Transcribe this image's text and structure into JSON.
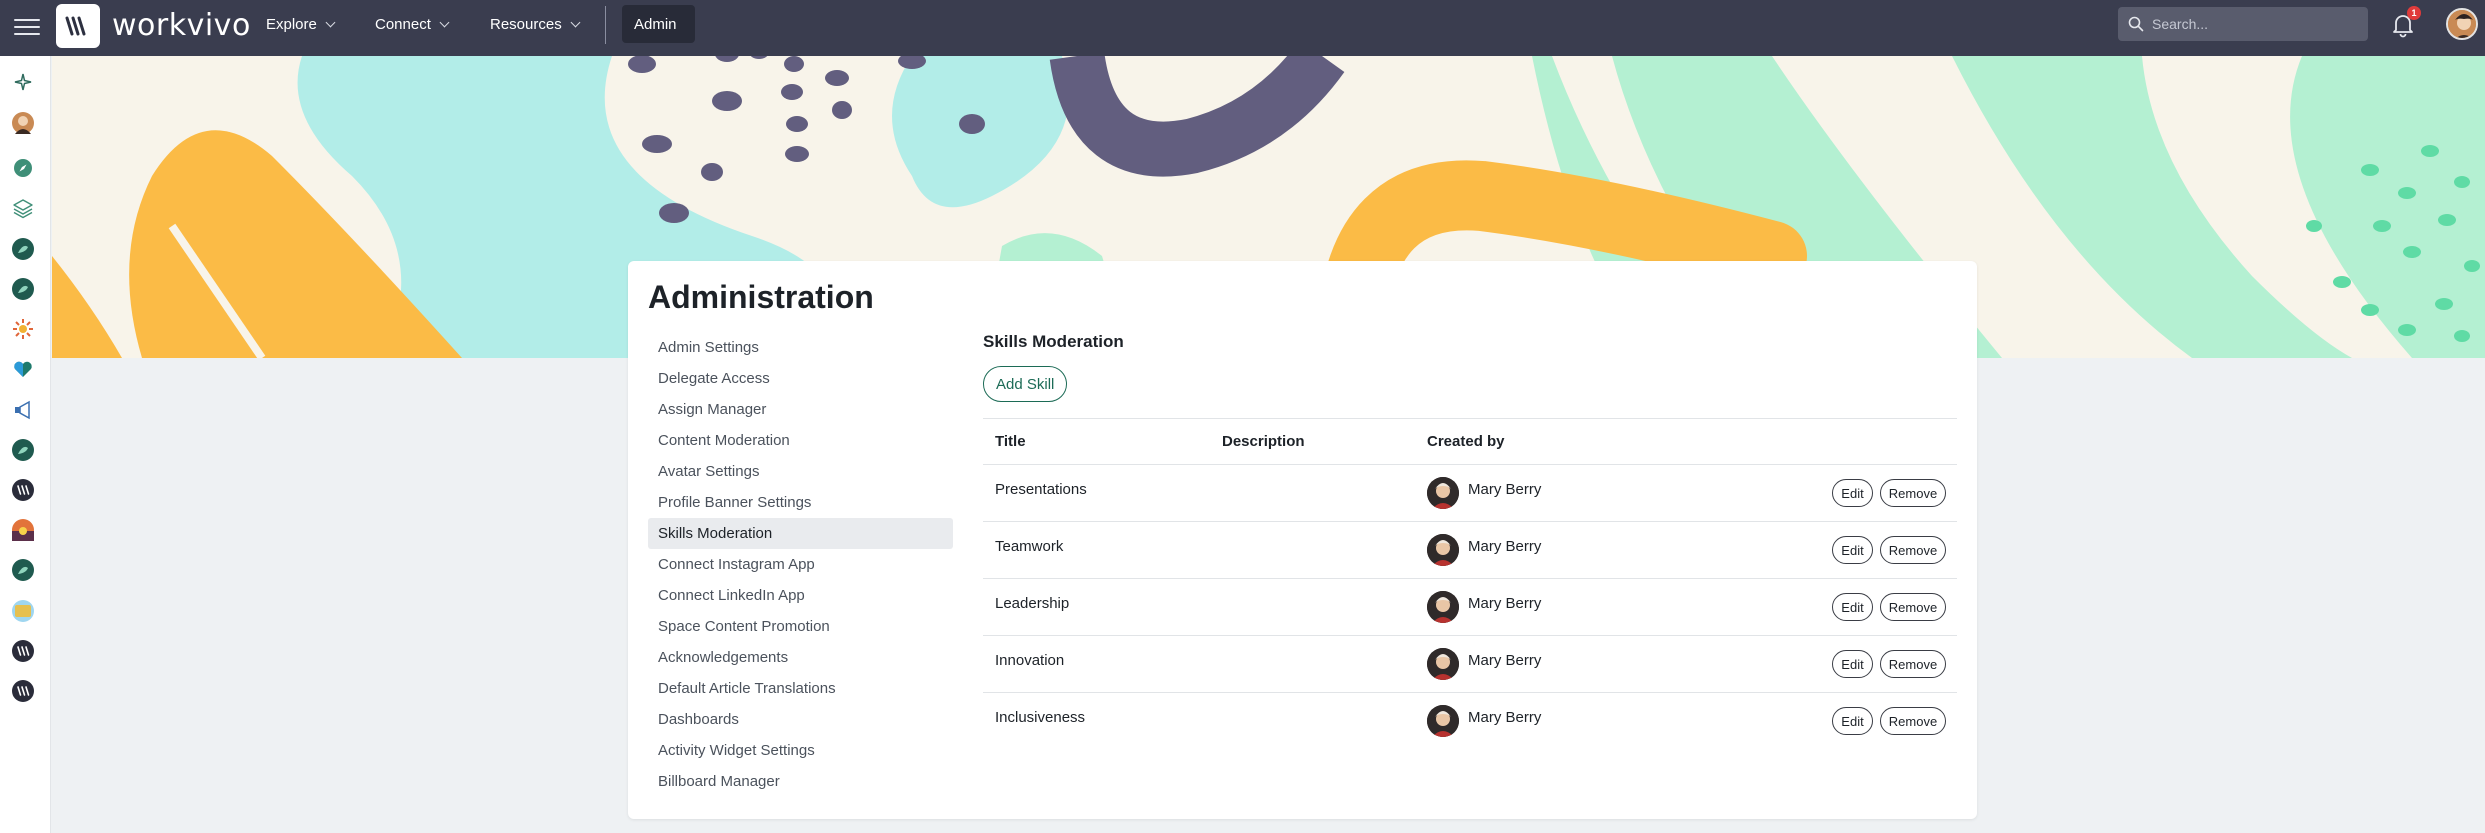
{
  "header": {
    "logo_text": "workvivo",
    "nav": [
      {
        "label": "Explore"
      },
      {
        "label": "Connect"
      },
      {
        "label": "Resources"
      }
    ],
    "admin_label": "Admin",
    "search_placeholder": "Search...",
    "notification_count": "1"
  },
  "page": {
    "title": "Administration"
  },
  "sidebar": {
    "items": [
      {
        "label": "Admin Settings"
      },
      {
        "label": "Delegate Access"
      },
      {
        "label": "Assign Manager"
      },
      {
        "label": "Content Moderation"
      },
      {
        "label": "Avatar Settings"
      },
      {
        "label": "Profile Banner Settings"
      },
      {
        "label": "Skills Moderation",
        "active": true
      },
      {
        "label": "Connect Instagram App"
      },
      {
        "label": "Connect LinkedIn App"
      },
      {
        "label": "Space Content Promotion"
      },
      {
        "label": "Acknowledgements"
      },
      {
        "label": "Default Article Translations"
      },
      {
        "label": "Dashboards"
      },
      {
        "label": "Activity Widget Settings"
      },
      {
        "label": "Billboard Manager"
      }
    ]
  },
  "skills": {
    "title": "Skills Moderation",
    "add_label": "Add Skill",
    "columns": {
      "title": "Title",
      "description": "Description",
      "created_by": "Created by"
    },
    "edit_label": "Edit",
    "remove_label": "Remove",
    "rows": [
      {
        "title": "Presentations",
        "description": "",
        "created_by": "Mary Berry"
      },
      {
        "title": "Teamwork",
        "description": "",
        "created_by": "Mary Berry"
      },
      {
        "title": "Leadership",
        "description": "",
        "created_by": "Mary Berry"
      },
      {
        "title": "Innovation",
        "description": "",
        "created_by": "Mary Berry"
      },
      {
        "title": "Inclusiveness",
        "description": "",
        "created_by": "Mary Berry"
      }
    ]
  },
  "rail": {
    "items": [
      {
        "icon": "sparkle-icon",
        "color": "#2f6b5e"
      },
      {
        "icon": "avatar-icon",
        "color": "#c98a54"
      },
      {
        "icon": "compass-icon",
        "color": "#3f8f78"
      },
      {
        "icon": "layers-icon",
        "color": "#3f8f78"
      },
      {
        "icon": "space-icon",
        "color": "#1f5a4f"
      },
      {
        "icon": "space-icon",
        "color": "#1f5a4f"
      },
      {
        "icon": "sunburst-icon",
        "color": "#e0663a"
      },
      {
        "icon": "heart-icon",
        "color": "#1e7a6c"
      },
      {
        "icon": "megaphone-icon",
        "color": "#3a6fb0"
      },
      {
        "icon": "space-icon",
        "color": "#1f5a4f"
      },
      {
        "icon": "workvivo-icon",
        "color": "#2a2c3a"
      },
      {
        "icon": "sunset-icon",
        "color": "#e2733a"
      },
      {
        "icon": "space-icon",
        "color": "#1f5a4f"
      },
      {
        "icon": "landscape-icon",
        "color": "#e6c04f"
      },
      {
        "icon": "workvivo-icon",
        "color": "#2a2c3a"
      },
      {
        "icon": "workvivo-icon",
        "color": "#2a2c3a"
      }
    ]
  },
  "colors": {
    "topbar": "#3a3d4f",
    "accent": "#1c6b56",
    "banner_teal": "#b2ede8",
    "banner_mint": "#b4f0d2",
    "banner_orange": "#fbbb46",
    "banner_purple": "#625e7f"
  }
}
